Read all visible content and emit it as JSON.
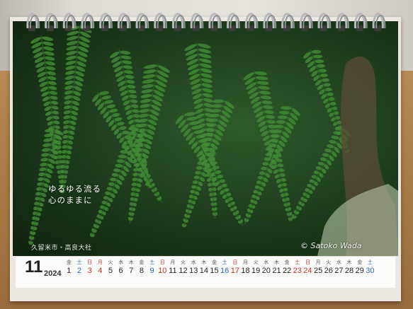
{
  "calendar": {
    "month": "11",
    "year": "2024",
    "tagline": [
      "ゆるゆる流る",
      "心のままに"
    ],
    "location": "久留米市・高良大社",
    "credit": "© Satoko Wada",
    "days": [
      {
        "dow": "金",
        "num": "1",
        "kind": "weekday"
      },
      {
        "dow": "土",
        "num": "2",
        "kind": "sat"
      },
      {
        "dow": "日",
        "num": "3",
        "kind": "sun"
      },
      {
        "dow": "月",
        "num": "4",
        "kind": "hol"
      },
      {
        "dow": "火",
        "num": "5",
        "kind": "weekday"
      },
      {
        "dow": "水",
        "num": "6",
        "kind": "weekday"
      },
      {
        "dow": "木",
        "num": "7",
        "kind": "weekday"
      },
      {
        "dow": "金",
        "num": "8",
        "kind": "weekday"
      },
      {
        "dow": "土",
        "num": "9",
        "kind": "sat"
      },
      {
        "dow": "日",
        "num": "10",
        "kind": "sun"
      },
      {
        "dow": "月",
        "num": "11",
        "kind": "weekday"
      },
      {
        "dow": "火",
        "num": "12",
        "kind": "weekday"
      },
      {
        "dow": "水",
        "num": "13",
        "kind": "weekday"
      },
      {
        "dow": "木",
        "num": "14",
        "kind": "weekday"
      },
      {
        "dow": "金",
        "num": "15",
        "kind": "weekday"
      },
      {
        "dow": "土",
        "num": "16",
        "kind": "sat"
      },
      {
        "dow": "日",
        "num": "17",
        "kind": "sun"
      },
      {
        "dow": "月",
        "num": "18",
        "kind": "weekday"
      },
      {
        "dow": "火",
        "num": "19",
        "kind": "weekday"
      },
      {
        "dow": "水",
        "num": "20",
        "kind": "weekday"
      },
      {
        "dow": "木",
        "num": "21",
        "kind": "weekday"
      },
      {
        "dow": "金",
        "num": "22",
        "kind": "weekday"
      },
      {
        "dow": "土",
        "num": "23",
        "kind": "hol"
      },
      {
        "dow": "日",
        "num": "24",
        "kind": "sun"
      },
      {
        "dow": "月",
        "num": "25",
        "kind": "weekday"
      },
      {
        "dow": "火",
        "num": "26",
        "kind": "weekday"
      },
      {
        "dow": "水",
        "num": "27",
        "kind": "weekday"
      },
      {
        "dow": "木",
        "num": "28",
        "kind": "weekday"
      },
      {
        "dow": "金",
        "num": "29",
        "kind": "weekday"
      },
      {
        "dow": "土",
        "num": "30",
        "kind": "sat"
      }
    ],
    "colors": {
      "saturday": "#2d67b2",
      "sunday_holiday": "#c9302c",
      "fern": "#3f8a34"
    }
  }
}
